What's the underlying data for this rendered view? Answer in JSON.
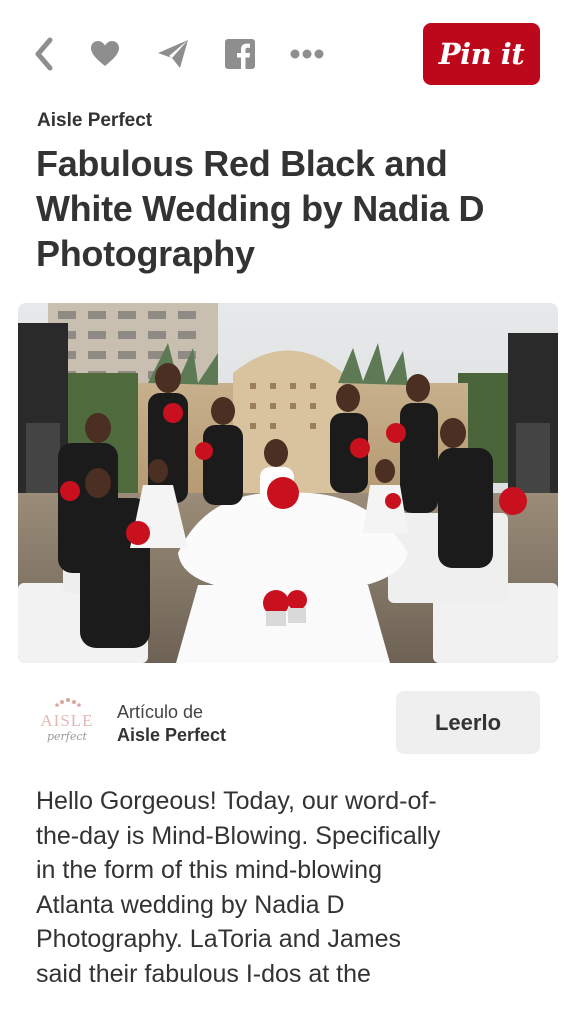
{
  "toolbar": {
    "icons": [
      "back-icon",
      "heart-icon",
      "send-icon",
      "facebook-icon",
      "more-icon"
    ],
    "pin_label": "Pin it",
    "brand_color": "#bd081c"
  },
  "pin": {
    "source_name": "Aisle Perfect",
    "title": "Fabulous Red Black and White Wedding by Nadia D Photography"
  },
  "article": {
    "label": "Artículo de",
    "source": "Aisle Perfect",
    "logo_text": "AISLE",
    "logo_script": "perfect",
    "read_button": "Leerlo"
  },
  "description": "Hello Gorgeous! Today, our word-of-the-day is Mind-Blowing. Specifically in the form of this mind-blowing Atlanta wedding by Nadia D Photography. LaToria and James said their fabulous I-dos at the"
}
